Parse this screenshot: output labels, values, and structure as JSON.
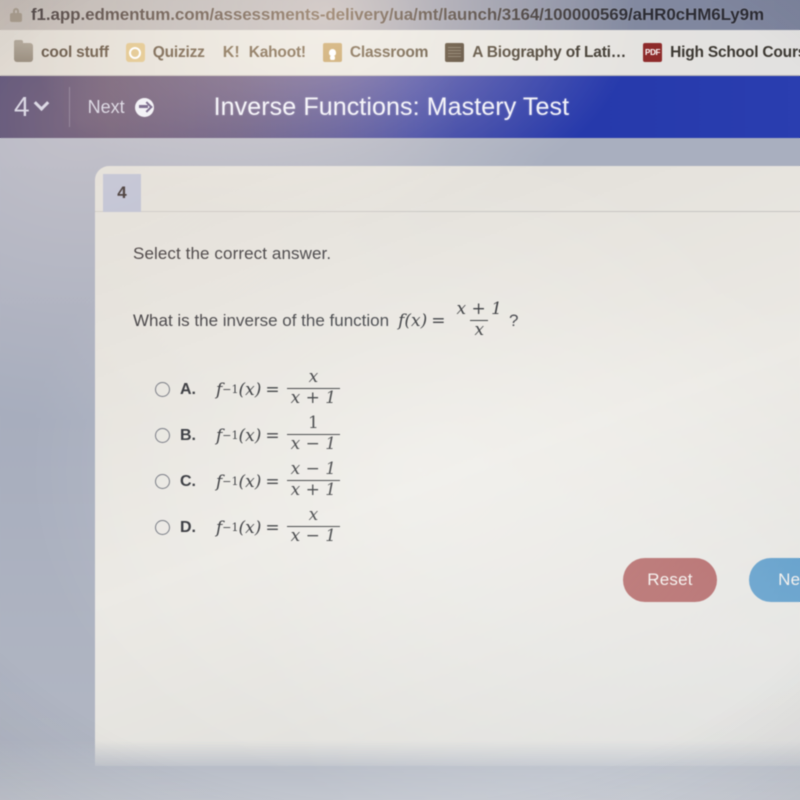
{
  "browser": {
    "url": "f1.app.edmentum.com/assessments-delivery/ua/mt/launch/3164/100000569/aHR0cHM6Ly9m",
    "lock_icon": "lock-icon",
    "bookmarks": [
      {
        "label": "cool stuff",
        "icon": "folder-icon"
      },
      {
        "label": "Quizizz",
        "icon": "quizizz-icon"
      },
      {
        "label": "Kahoot!",
        "icon": "kahoot-icon",
        "glyph": "K!"
      },
      {
        "label": "Classroom",
        "icon": "classroom-icon"
      },
      {
        "label": "A Biography of Lati…",
        "icon": "book-icon"
      },
      {
        "label": "High School Cours",
        "icon": "pdf-icon",
        "glyph": "PDF"
      }
    ]
  },
  "appbar": {
    "question_number": "4",
    "dropdown_icon": "chevron-down-icon",
    "next_label": "Next",
    "next_icon": "arrow-right-circle-icon",
    "title": "Inverse Functions: Mastery Test",
    "background_color": "#2a3eb0"
  },
  "question": {
    "tab_number": "4",
    "instruction": "Select the correct answer.",
    "prompt": "What is the inverse of the function",
    "prompt_suffix": "?",
    "function": {
      "name": "f",
      "arg": "(x)",
      "equals": "=",
      "numerator": "x + 1",
      "denominator": "x"
    },
    "choices": [
      {
        "letter": "A.",
        "lhs": "f",
        "exp": "−1",
        "arg": "(x)",
        "equals": "=",
        "numerator": "x",
        "denominator": "x + 1",
        "selected": false
      },
      {
        "letter": "B.",
        "lhs": "f",
        "exp": "−1",
        "arg": "(x)",
        "equals": "=",
        "numerator": "1",
        "denominator": "x − 1",
        "selected": false
      },
      {
        "letter": "C.",
        "lhs": "f",
        "exp": "−1",
        "arg": "(x)",
        "equals": "=",
        "numerator": "x − 1",
        "denominator": "x + 1",
        "selected": false
      },
      {
        "letter": "D.",
        "lhs": "f",
        "exp": "−1",
        "arg": "(x)",
        "equals": "=",
        "numerator": "x",
        "denominator": "x − 1",
        "selected": false
      }
    ]
  },
  "actions": {
    "reset_label": "Reset",
    "reset_color": "#a85050",
    "next_label": "Next",
    "next_color": "#4b8fc2"
  }
}
